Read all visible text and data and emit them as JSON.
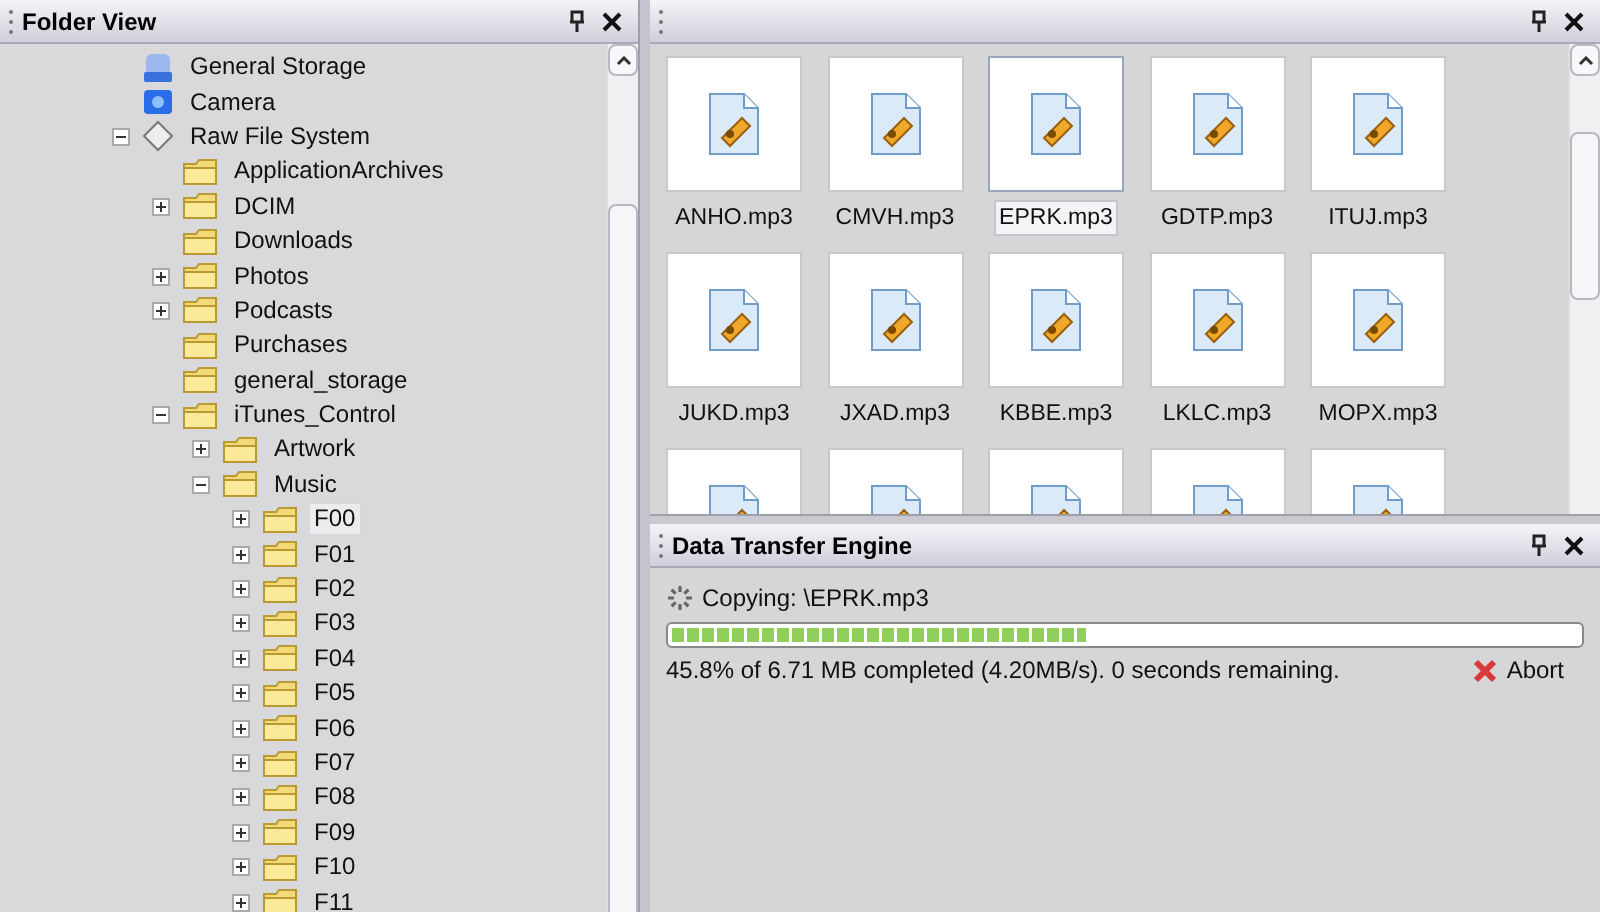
{
  "folder_panel": {
    "title": "Folder View",
    "tree": [
      {
        "label": "General Storage",
        "kind": "drive",
        "selected": false
      },
      {
        "label": "Camera",
        "kind": "camera",
        "selected": false
      },
      {
        "label": "Raw File System",
        "kind": "raw",
        "expanded": true,
        "selected": false,
        "children": [
          {
            "label": "ApplicationArchives",
            "kind": "folder",
            "selected": false
          },
          {
            "label": "DCIM",
            "kind": "folder",
            "expanded": false,
            "selected": false
          },
          {
            "label": "Downloads",
            "kind": "folder",
            "selected": false
          },
          {
            "label": "Photos",
            "kind": "folder",
            "expanded": false,
            "selected": false
          },
          {
            "label": "Podcasts",
            "kind": "folder",
            "expanded": false,
            "selected": false
          },
          {
            "label": "Purchases",
            "kind": "folder",
            "selected": false
          },
          {
            "label": "general_storage",
            "kind": "folder",
            "selected": false
          },
          {
            "label": "iTunes_Control",
            "kind": "folder",
            "expanded": true,
            "selected": false,
            "children": [
              {
                "label": "Artwork",
                "kind": "folder",
                "expanded": false,
                "selected": false
              },
              {
                "label": "Music",
                "kind": "folder",
                "expanded": true,
                "selected": false,
                "children": [
                  {
                    "label": "F00",
                    "kind": "folder",
                    "expanded": false,
                    "selected": true
                  },
                  {
                    "label": "F01",
                    "kind": "folder",
                    "expanded": false,
                    "selected": false
                  },
                  {
                    "label": "F02",
                    "kind": "folder",
                    "expanded": false,
                    "selected": false
                  },
                  {
                    "label": "F03",
                    "kind": "folder",
                    "expanded": false,
                    "selected": false
                  },
                  {
                    "label": "F04",
                    "kind": "folder",
                    "expanded": false,
                    "selected": false
                  },
                  {
                    "label": "F05",
                    "kind": "folder",
                    "expanded": false,
                    "selected": false
                  },
                  {
                    "label": "F06",
                    "kind": "folder",
                    "expanded": false,
                    "selected": false
                  },
                  {
                    "label": "F07",
                    "kind": "folder",
                    "expanded": false,
                    "selected": false
                  },
                  {
                    "label": "F08",
                    "kind": "folder",
                    "expanded": false,
                    "selected": false
                  },
                  {
                    "label": "F09",
                    "kind": "folder",
                    "expanded": false,
                    "selected": false
                  },
                  {
                    "label": "F10",
                    "kind": "folder",
                    "expanded": false,
                    "selected": false
                  },
                  {
                    "label": "F11",
                    "kind": "folder",
                    "expanded": false,
                    "selected": false
                  }
                ]
              }
            ]
          }
        ]
      }
    ]
  },
  "files_panel": {
    "files": [
      {
        "name": "ANHO.mp3",
        "selected": false
      },
      {
        "name": "CMVH.mp3",
        "selected": false
      },
      {
        "name": "EPRK.mp3",
        "selected": true
      },
      {
        "name": "GDTP.mp3",
        "selected": false
      },
      {
        "name": "ITUJ.mp3",
        "selected": false
      },
      {
        "name": "JUKD.mp3",
        "selected": false
      },
      {
        "name": "JXAD.mp3",
        "selected": false
      },
      {
        "name": "KBBE.mp3",
        "selected": false
      },
      {
        "name": "LKLC.mp3",
        "selected": false
      },
      {
        "name": "MOPX.mp3",
        "selected": false
      },
      {
        "selected": false
      },
      {
        "selected": false
      },
      {
        "selected": false
      },
      {
        "selected": false
      },
      {
        "selected": false
      }
    ]
  },
  "transfer_panel": {
    "title": "Data Transfer Engine",
    "status": "Copying: \\EPRK.mp3",
    "level": 0.458,
    "progress_text": "45.8% of 6.71 MB completed (4.20MB/s). 0 seconds remaining.",
    "abort_button": "Abort"
  }
}
